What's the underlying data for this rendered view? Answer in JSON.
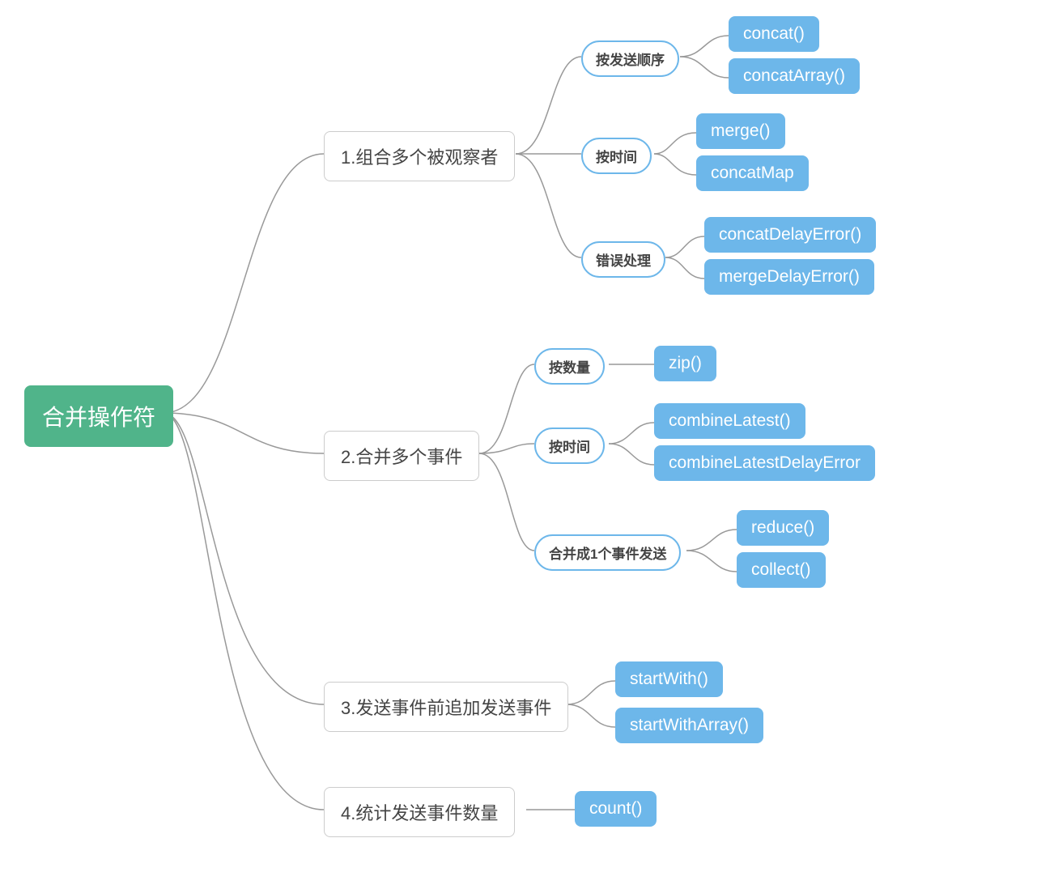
{
  "root": "合并操作符",
  "branches": [
    {
      "label": "1.组合多个被观察者",
      "children": [
        {
          "label": "按发送顺序",
          "leaves": [
            "concat()",
            "concatArray()"
          ]
        },
        {
          "label": "按时间",
          "leaves": [
            "merge()",
            "concatMap"
          ]
        },
        {
          "label": "错误处理",
          "leaves": [
            "concatDelayError()",
            "mergeDelayError()"
          ]
        }
      ]
    },
    {
      "label": "2.合并多个事件",
      "children": [
        {
          "label": "按数量",
          "leaves": [
            "zip()"
          ]
        },
        {
          "label": "按时间",
          "leaves": [
            "combineLatest()",
            "combineLatestDelayError"
          ]
        },
        {
          "label": "合并成1个事件发送",
          "leaves": [
            "reduce()",
            "collect()"
          ]
        }
      ]
    },
    {
      "label": "3.发送事件前追加发送事件",
      "leaves": [
        "startWith()",
        "startWithArray()"
      ]
    },
    {
      "label": "4.统计发送事件数量",
      "leaves": [
        "count()"
      ]
    }
  ],
  "colors": {
    "root_bg": "#50b48a",
    "leaf_bg": "#6db7ea",
    "pill_border": "#6db7ea",
    "box_border": "#cccccc",
    "connector": "#999999"
  }
}
